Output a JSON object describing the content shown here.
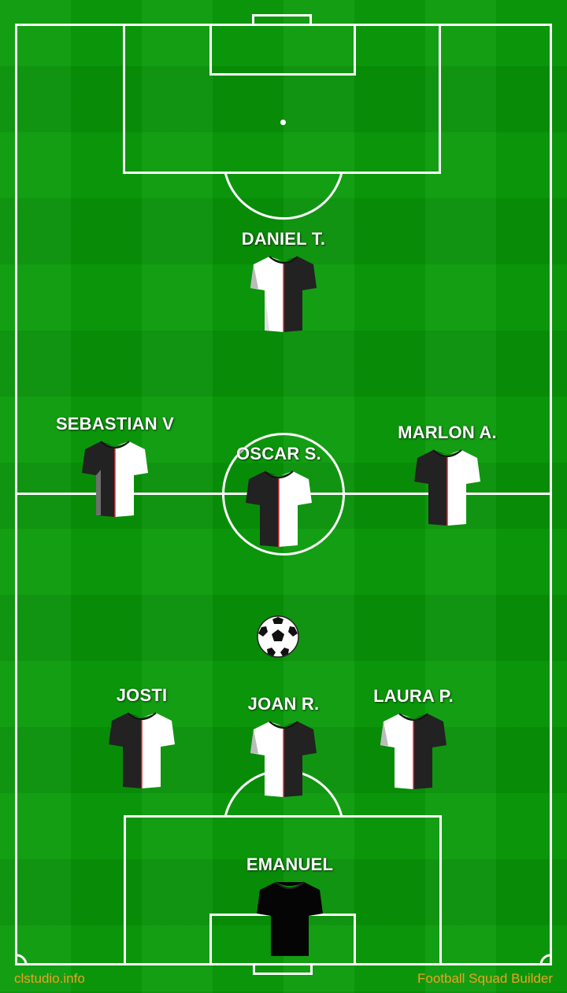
{
  "players": [
    {
      "name": "DANIEL T.",
      "kit": "outfield"
    },
    {
      "name": "SEBASTIAN V",
      "kit": "outfield"
    },
    {
      "name": "OSCAR S.",
      "kit": "outfield"
    },
    {
      "name": "MARLON A.",
      "kit": "outfield"
    },
    {
      "name": "JOSTI",
      "kit": "outfield"
    },
    {
      "name": "JOAN R.",
      "kit": "outfield"
    },
    {
      "name": "LAURA P.",
      "kit": "outfield"
    },
    {
      "name": "EMANUEL",
      "kit": "goalkeeper"
    }
  ],
  "footer": {
    "left": "clstudio.info",
    "right": "Football Squad Builder"
  },
  "colors": {
    "grass_light": "#0b9a0b",
    "grass_dark": "#089008",
    "lines": "#ffffff",
    "footer_text": "#f0a020",
    "kit_black": "#222222",
    "kit_white": "#ffffff",
    "kit_trim": "#e0303a"
  }
}
